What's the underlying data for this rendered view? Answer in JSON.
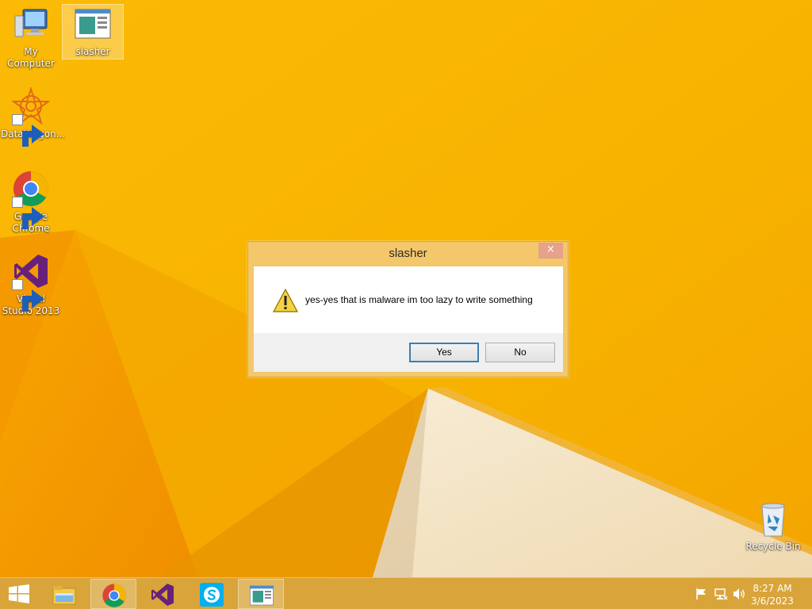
{
  "desktop": {
    "icons": [
      {
        "label": "My Computer",
        "icon": "computer-icon"
      },
      {
        "label": "slasher",
        "icon": "app-window-icon",
        "selected": true
      },
      {
        "label": "DataWagon...",
        "icon": "datawagon-icon"
      },
      {
        "label": "Google Chrome",
        "icon": "chrome-icon"
      },
      {
        "label": "Visual Studio 2013",
        "icon": "visual-studio-icon"
      },
      {
        "label": "Recycle Bin",
        "icon": "recycle-bin-icon"
      }
    ]
  },
  "dialog": {
    "title": "slasher",
    "close_glyph": "×",
    "message": "yes-yes that is malware im too lazy to write something",
    "icon": "warning-icon",
    "buttons": {
      "yes": "Yes",
      "no": "No"
    }
  },
  "taskbar": {
    "start": "windows-logo-icon",
    "pinned": [
      {
        "name": "file-explorer-icon"
      },
      {
        "name": "chrome-icon",
        "active": true
      },
      {
        "name": "visual-studio-icon"
      },
      {
        "name": "skype-icon"
      },
      {
        "name": "slasher-icon",
        "active": true
      }
    ],
    "tray": [
      "action-center-flag-icon",
      "network-icon",
      "volume-icon"
    ],
    "clock": {
      "time": "8:27 AM",
      "date": "3/6/2023"
    }
  },
  "colors": {
    "wallpaper": "#f6b400",
    "dialog_frame": "#f3c76a",
    "close_button": "#e6a28b",
    "taskbar": "#d9a43a"
  }
}
